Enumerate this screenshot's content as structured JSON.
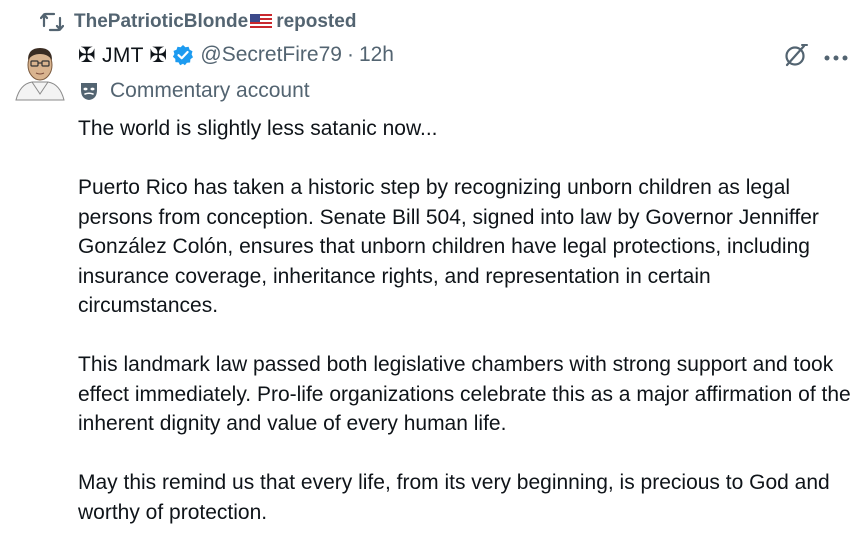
{
  "repost": {
    "icon": "repost-icon",
    "username": "ThePatrioticBlonde",
    "flag": "us-flag-icon",
    "suffix": " reposted"
  },
  "author": {
    "avatar": "avatar",
    "display_name": "✠ JMT ✠",
    "verified_icon": "verified-badge-icon",
    "handle": "@SecretFire79",
    "separator": "·",
    "time": "12h"
  },
  "account_label": {
    "icon": "theater-mask-icon",
    "text": "Commentary account"
  },
  "header_actions": {
    "grok_icon": "grok-icon",
    "more_icon": "more-icon"
  },
  "tweet": {
    "paragraphs": [
      "The world is slightly less satanic now...",
      "Puerto Rico has taken a historic step by recognizing unborn children as legal persons from conception. Senate Bill 504, signed into law by Governor Jenniffer González Colón, ensures that unborn children have legal protections, including insurance coverage, inheritance rights, and representation in certain circumstances.",
      "This landmark law passed both legislative chambers with strong support and took effect immediately. Pro-life organizations celebrate this as a major affirmation of the inherent dignity and value of every human life.",
      "May this remind us that every life, from its very beginning, is precious to God and worthy of protection."
    ]
  },
  "colors": {
    "text": "#0f1419",
    "secondary": "#536471",
    "verified": "#1d9bf0"
  }
}
